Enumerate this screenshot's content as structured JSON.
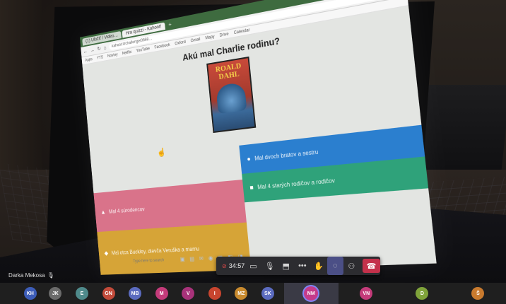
{
  "browser": {
    "tabs": [
      {
        "label": "(1) Uložiť / Video…"
      },
      {
        "label": "Hra quizzi - Kahoot!"
      },
      {
        "label": "+"
      }
    ],
    "url": "kahoot.it/challenge/0668…",
    "bookmarks": [
      "Apps",
      "YTS",
      "Noviny",
      "Netflix",
      "YouTube",
      "Facebook",
      "Oxford",
      "Gmail",
      "Mapy",
      "Drive",
      "Calendar"
    ]
  },
  "quiz": {
    "question": "Akú mal Charlie rodinu?",
    "book": {
      "title_line1": "ROALD",
      "title_line2": "DAHL"
    },
    "answers": [
      {
        "shape": "●",
        "text": "Mal dvoch bratov a sestru"
      },
      {
        "shape": "■",
        "text": "Mal 4 starých rodičov a rodičov"
      },
      {
        "shape": "▲",
        "text": "Mal 4 súrodencov"
      },
      {
        "shape": "◆",
        "text": "Mal otca Buckley, dievča Veruška a mamu"
      }
    ],
    "type_hint": "Type here to search"
  },
  "call": {
    "timer": "34:57",
    "self_name": "Darka Mekosa"
  },
  "participants": [
    {
      "initials": "KH",
      "color": "#3d5db8"
    },
    {
      "initials": "JK",
      "color": "#6b6b6b"
    },
    {
      "initials": "E",
      "color": "#4f8a8b"
    },
    {
      "initials": "GN",
      "color": "#c24a3a"
    },
    {
      "initials": "MB",
      "color": "#5b6bbf"
    },
    {
      "initials": "M",
      "color": "#c43b7a"
    },
    {
      "initials": "V",
      "color": "#a8327a"
    },
    {
      "initials": "I",
      "color": "#c8452f"
    },
    {
      "initials": "MZ",
      "color": "#c88a2e"
    },
    {
      "initials": "SK",
      "color": "#5b6bbf"
    },
    {
      "initials": "NM",
      "color": "#c43b8a"
    },
    {
      "initials": "VN",
      "color": "#c43b7a"
    },
    {
      "initials": "D",
      "color": "#7fa33a"
    },
    {
      "initials": "Š",
      "color": "#c87a2e"
    }
  ]
}
